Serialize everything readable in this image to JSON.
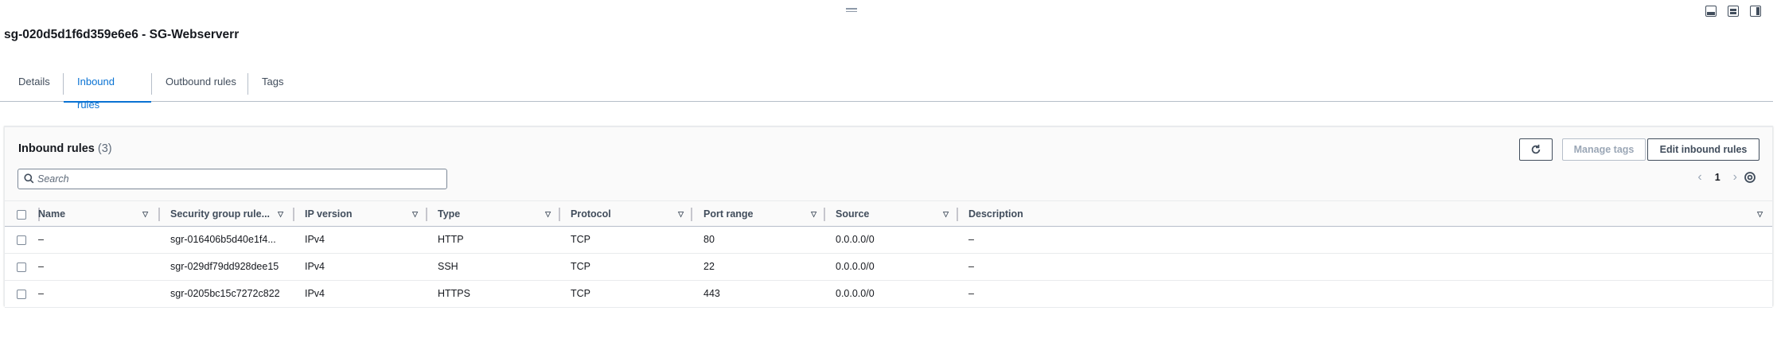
{
  "header": {
    "title": "sg-020d5d1f6d359e6e6 - SG-Webserverr"
  },
  "tabs": [
    {
      "label": "Details"
    },
    {
      "label": "Inbound rules"
    },
    {
      "label": "Outbound rules"
    },
    {
      "label": "Tags"
    }
  ],
  "active_tab": "Inbound rules",
  "panel": {
    "title": "Inbound rules",
    "count": "(3)",
    "refresh_icon": "refresh-icon",
    "manage_tags_label": "Manage tags",
    "edit_rules_label": "Edit inbound rules",
    "search_placeholder": "Search",
    "page": "1"
  },
  "table": {
    "columns": [
      "Name",
      "Security group rule...",
      "IP version",
      "Type",
      "Protocol",
      "Port range",
      "Source",
      "Description"
    ],
    "rows": [
      {
        "name": "–",
        "rule_id": "sgr-016406b5d40e1f4...",
        "ip_version": "IPv4",
        "type": "HTTP",
        "protocol": "TCP",
        "port_range": "80",
        "source": "0.0.0.0/0",
        "description": "–"
      },
      {
        "name": "–",
        "rule_id": "sgr-029df79dd928dee15",
        "ip_version": "IPv4",
        "type": "SSH",
        "protocol": "TCP",
        "port_range": "22",
        "source": "0.0.0.0/0",
        "description": "–"
      },
      {
        "name": "–",
        "rule_id": "sgr-0205bc15c7272c822",
        "ip_version": "IPv4",
        "type": "HTTPS",
        "protocol": "TCP",
        "port_range": "443",
        "source": "0.0.0.0/0",
        "description": "–"
      }
    ]
  },
  "colors": {
    "accent": "#0972d3",
    "text": "#16191f",
    "border": "#b6bec9"
  }
}
